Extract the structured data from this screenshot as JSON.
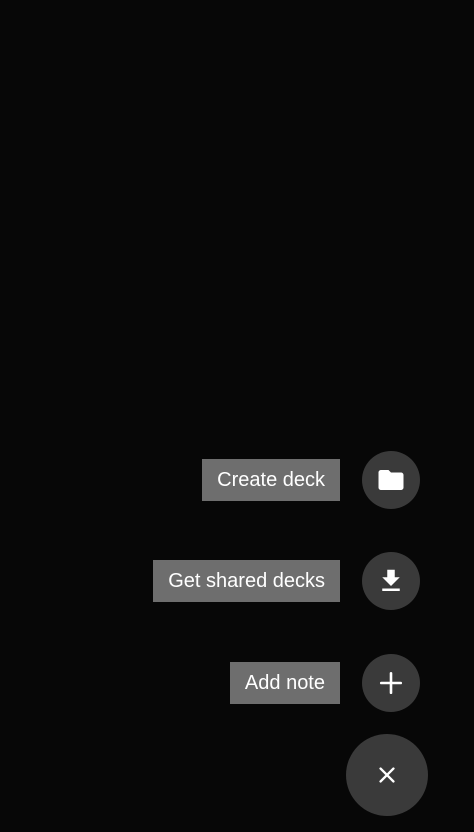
{
  "fab_menu": {
    "items": [
      {
        "label": "Create deck",
        "icon": "folder-icon"
      },
      {
        "label": "Get shared decks",
        "icon": "download-icon"
      },
      {
        "label": "Add note",
        "icon": "plus-icon"
      }
    ],
    "close_icon": "close-icon"
  },
  "colors": {
    "background": "#070707",
    "label_bg": "#6e6e6e",
    "fab_bg": "#3a3a3a",
    "foreground": "#ffffff"
  }
}
